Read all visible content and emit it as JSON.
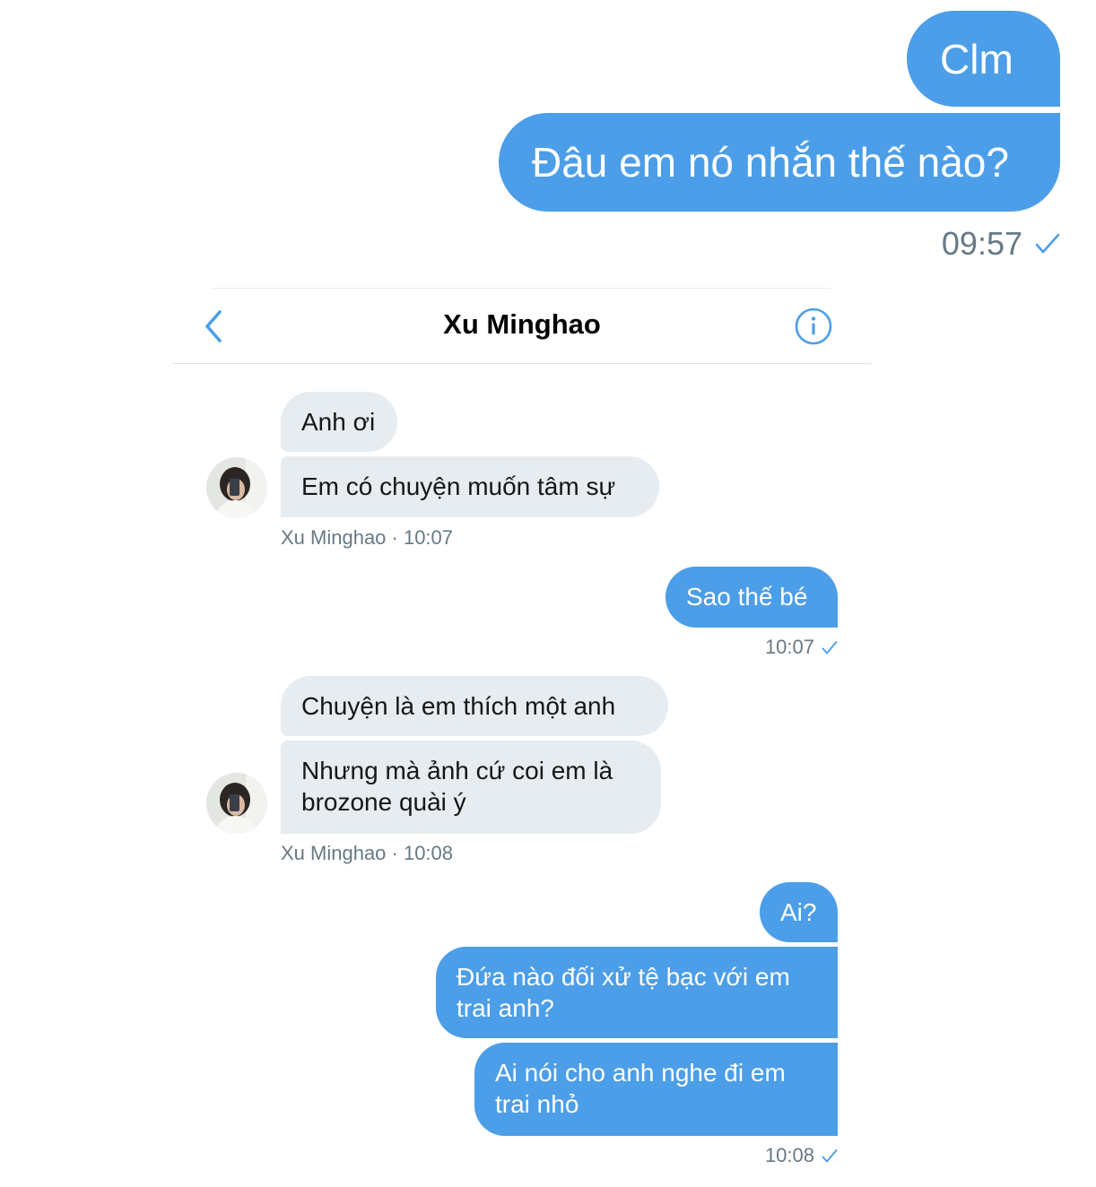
{
  "outer_chat": {
    "messages": [
      {
        "text": "Clm"
      },
      {
        "text": "Đâu em nó nhắn thế nào?"
      }
    ],
    "time": "09:57",
    "status_icon": "checkmark-icon"
  },
  "screenshot": {
    "header": {
      "title": "Xu Minghao",
      "back_icon": "chevron-left-icon",
      "info_icon": "info-icon"
    },
    "groups": [
      {
        "messages": [
          "Anh ơi",
          "Em có chuyện muốn tâm sự"
        ],
        "meta": "Xu Minghao · 10:07"
      },
      {
        "messages": [
          "Sao thế bé"
        ],
        "meta": "10:07"
      },
      {
        "messages": [
          "Chuyện là em thích một anh",
          "Nhưng mà ảnh cứ coi em là brozone quài ý"
        ],
        "lines": [
          "Nhưng mà ảnh cứ coi em là",
          "brozone quài ý"
        ],
        "meta": "Xu Minghao · 10:08"
      },
      {
        "messages": [
          "Ai?",
          "Đứa nào đối xử tệ bạc với em trai anh?",
          "Ai nói cho anh nghe đi em trai nhỏ"
        ],
        "lines": {
          "m2": [
            "Đứa nào đối xử tệ bạc với em",
            "trai anh?"
          ],
          "m3": [
            "Ai nói cho anh nghe đi em",
            "trai nhỏ"
          ]
        },
        "meta": "10:08"
      }
    ]
  },
  "colors": {
    "outgoing": "#4c9ee8",
    "incoming": "#e6ecf0",
    "meta_text": "#677985",
    "accent": "#4c9ee8"
  }
}
